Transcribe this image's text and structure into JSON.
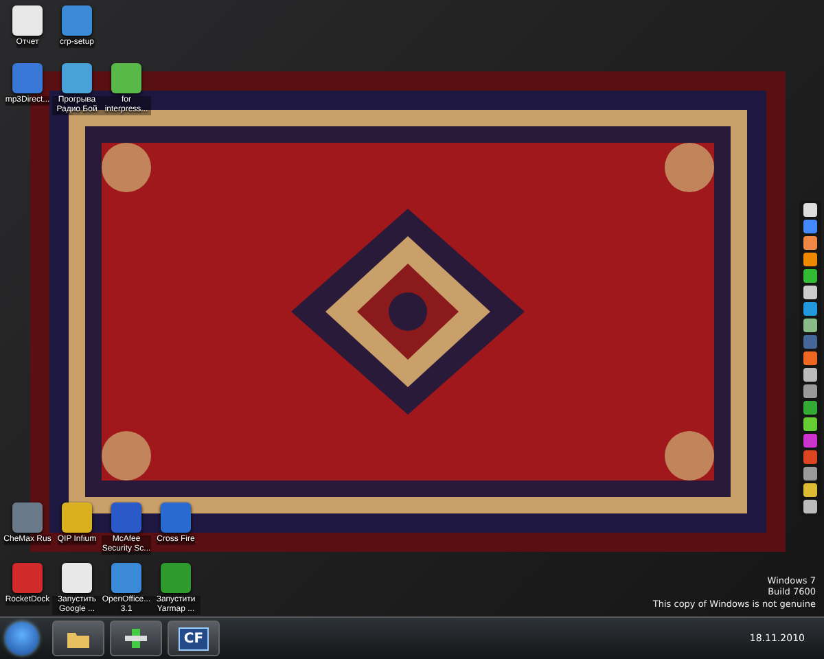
{
  "icon_rows": [
    [
      {
        "label": "Отчет"
      },
      {
        "label": "crp-setup"
      }
    ],
    [
      {
        "label": "mp3Direct..."
      },
      {
        "label": "Прогрыва Радио Бой"
      },
      {
        "label": "for interpress..."
      }
    ],
    [
      {
        "label": "CheMax Rus"
      },
      {
        "label": "QIP Infium"
      },
      {
        "label": "McAfee Security Sc..."
      },
      {
        "label": "Cross Fire"
      }
    ],
    [
      {
        "label": "RocketDock"
      },
      {
        "label": "Запустить Google ..."
      },
      {
        "label": "OpenOffice... 3.1"
      },
      {
        "label": "Запустити Yarmap ..."
      }
    ]
  ],
  "notice": [
    "Windows 7",
    "Build 7600",
    "This copy of Windows is not genuine"
  ],
  "taskbar": {
    "buttons": [
      {
        "kind": "folder"
      },
      {
        "kind": "app"
      },
      {
        "kind": "text",
        "label": "CF"
      }
    ],
    "date": "18.11.2010"
  }
}
